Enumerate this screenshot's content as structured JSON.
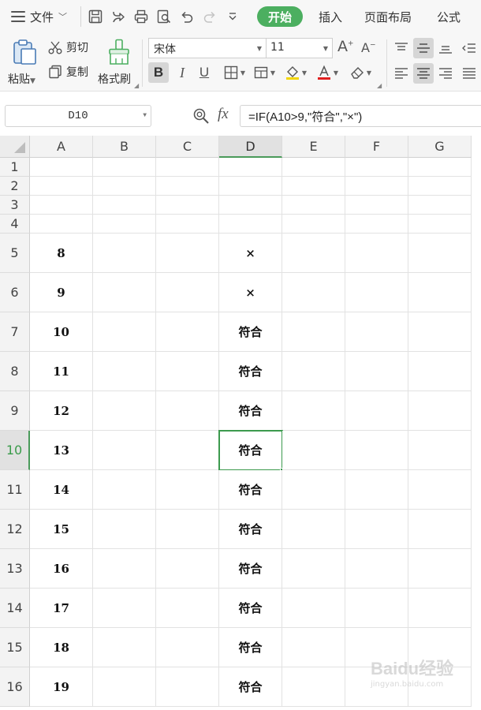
{
  "menubar": {
    "file_label": "文件",
    "tabs": [
      {
        "label": "开始",
        "active": true
      },
      {
        "label": "插入",
        "active": false
      },
      {
        "label": "页面布局",
        "active": false
      },
      {
        "label": "公式",
        "active": false
      }
    ]
  },
  "ribbon": {
    "paste_label": "粘贴",
    "cut_label": "剪切",
    "copy_label": "复制",
    "format_painter_label": "格式刷",
    "font_name": "宋体",
    "font_size": "11",
    "bold_label": "B",
    "italic_label": "I",
    "underline_label": "U"
  },
  "formula_bar": {
    "name_box": "D10",
    "formula": "=IF(A10>9,\"符合\",\"×\")"
  },
  "columns": [
    "A",
    "B",
    "C",
    "D",
    "E",
    "F",
    "G"
  ],
  "selected_column": "D",
  "selected_row": "10",
  "rows": [
    {
      "num": "1",
      "a": "",
      "d": ""
    },
    {
      "num": "2",
      "a": "",
      "d": ""
    },
    {
      "num": "3",
      "a": "",
      "d": ""
    },
    {
      "num": "4",
      "a": "",
      "d": ""
    },
    {
      "num": "5",
      "a": "8",
      "d": "×"
    },
    {
      "num": "6",
      "a": "9",
      "d": "×"
    },
    {
      "num": "7",
      "a": "10",
      "d": "符合"
    },
    {
      "num": "8",
      "a": "11",
      "d": "符合"
    },
    {
      "num": "9",
      "a": "12",
      "d": "符合"
    },
    {
      "num": "10",
      "a": "13",
      "d": "符合"
    },
    {
      "num": "11",
      "a": "14",
      "d": "符合"
    },
    {
      "num": "12",
      "a": "15",
      "d": "符合"
    },
    {
      "num": "13",
      "a": "16",
      "d": "符合"
    },
    {
      "num": "14",
      "a": "17",
      "d": "符合"
    },
    {
      "num": "15",
      "a": "18",
      "d": "符合"
    },
    {
      "num": "16",
      "a": "19",
      "d": "符合"
    }
  ],
  "colors": {
    "accent": "#4caf60",
    "selection_border": "#3c9a4e",
    "font_color_bar": "#e02020",
    "fill_color_bar": "#f2d600"
  },
  "icons": [
    "menu-icon",
    "save-icon",
    "export-icon",
    "print-icon",
    "print-preview-icon",
    "undo-icon",
    "redo-icon",
    "more-icon",
    "paste-icon",
    "scissors-icon",
    "copy-icon",
    "brush-icon",
    "font-grow-icon",
    "font-shrink-icon",
    "border-icon",
    "merge-icon",
    "fill-color-icon",
    "font-color-icon",
    "eraser-icon",
    "zoom-icon",
    "fx-icon"
  ],
  "watermark": {
    "line1": "Baidu经验",
    "line2": "jingyan.baidu.com"
  }
}
